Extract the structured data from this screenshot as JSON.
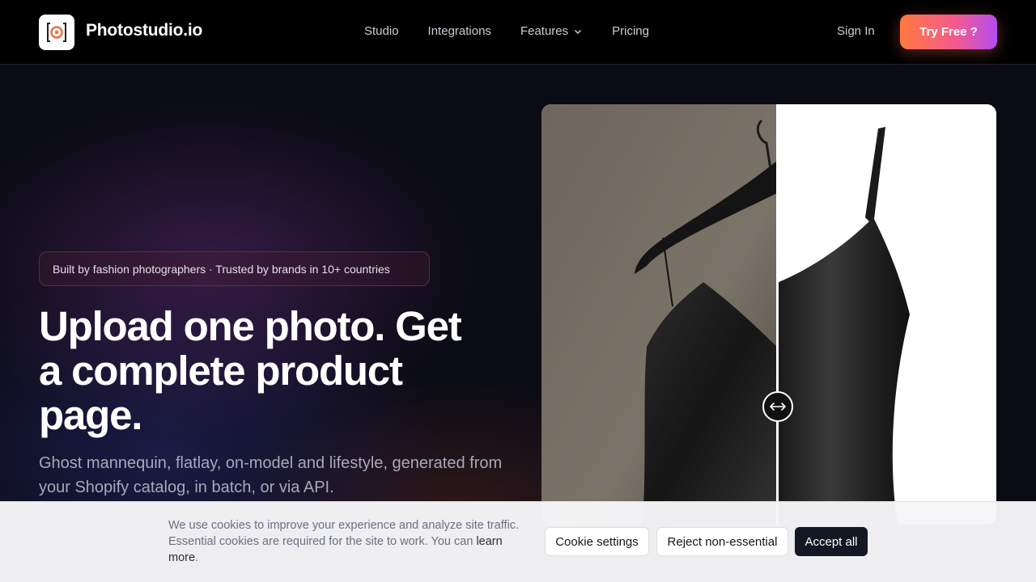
{
  "nav": {
    "brand": "Photostudio.io",
    "links": [
      "Studio",
      "Integrations",
      "Features",
      "Pricing"
    ],
    "sign_in": "Sign In",
    "cta": "Try Free ?"
  },
  "hero": {
    "badge": "Built by fashion photographers · Trusted by brands in 10+ countries",
    "headline": "Upload one photo. Get a complete product page.",
    "subhead": "Ghost mannequin, flatlay, on-model and lifestyle, generated from your Shopify catalog, in batch, or via API."
  },
  "compare": {
    "handle_icon": "arrows-horizontal-icon"
  },
  "cookie": {
    "text": "We use cookies to improve your experience and analyze site traffic. Essential cookies are required for the site to work. You can ",
    "link": "learn more",
    "text_end": ".",
    "settings": "Cookie settings",
    "reject": "Reject non-essential",
    "accept": "Accept all"
  },
  "colors": {
    "accent_start": "#ff7a3d",
    "accent_end": "#b44cf0",
    "accept_bg": "#141824"
  }
}
